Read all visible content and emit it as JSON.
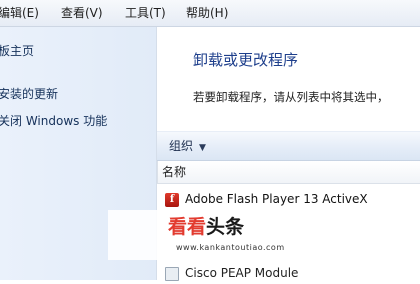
{
  "menu": {
    "items": [
      {
        "label": "编辑(E)"
      },
      {
        "label": "查看(V)"
      },
      {
        "label": "工具(T)"
      },
      {
        "label": "帮助(H)"
      }
    ]
  },
  "left_nav": {
    "links": [
      {
        "label": "板主页"
      },
      {
        "label": "安装的更新"
      },
      {
        "label": "关闭 Windows 功能"
      }
    ]
  },
  "main": {
    "title": "卸载或更改程序",
    "description": "若要卸载程序，请从列表中将其选中，",
    "toolbar": {
      "organize_label": "组织",
      "organize_arrow": "▼"
    },
    "columns": [
      {
        "label": "名称"
      }
    ],
    "programs": [
      {
        "name": "Adobe Flash Player 13 ActiveX",
        "icon": "flash-icon"
      },
      {
        "name": "Cisco PEAP Module",
        "icon": "program-icon"
      }
    ]
  },
  "watermark": {
    "brand_red": "看看",
    "brand_black": "头条",
    "url": "www.kankantoutiao.com"
  },
  "colors": {
    "title_blue": "#1e3f8c",
    "nav_bg": "#e1ebf8",
    "watermark_red": "#e23b2f"
  }
}
